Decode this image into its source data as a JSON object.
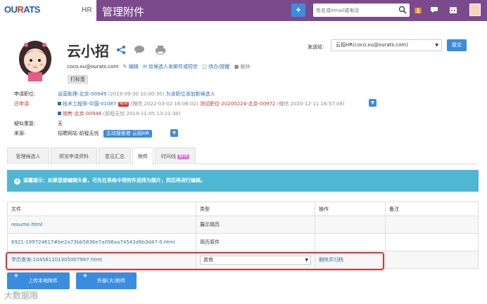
{
  "header": {
    "logo": "OURATS",
    "hr_label": "HR",
    "page_title": "管理附件",
    "search_placeholder": "姓名或email或电话"
  },
  "profile": {
    "name": "云小招",
    "email": "coco.xu@ourats.com",
    "actions": [
      "编辑",
      "给候选人发邮件或短信",
      "待办/提醒",
      "删除"
    ],
    "tag_button": "打标签",
    "forward_label": "发送给:",
    "forward_value": "云招HR(coco.xu@ourats.com)",
    "submit_label": "提交"
  },
  "details": {
    "applied_label": "申请职位:",
    "applied_job": "运营助理-北京-00949",
    "applied_time": "(2019-09-30 10:00:30)",
    "applied_add": "为该职位添加新候选人",
    "also_label": "还申请:",
    "also_jobs": [
      {
        "job": "技术工程师-中国-01087",
        "badge": "NEW",
        "note": "(微信 2022-03-02 16:06:02)",
        "job2": "测试职位-20200224-北京-00972",
        "note2": "(微信 2020-12-11 16:57:08)"
      },
      {
        "job": "销售-北京-00946",
        "note": "(前程无忧 2019-11-05 13:21:30)"
      }
    ],
    "doubt_label": "疑似重复:",
    "doubt_value": "无",
    "source_label": "来源:",
    "source_value": "招聘网站-前程无忧",
    "source_button": "主动搜索者 云招HR"
  },
  "tabs": [
    "管理候选人",
    "预览申请资料",
    "意见汇总",
    "附件",
    "时间线"
  ],
  "tab_beta": "BETA",
  "active_tab": 3,
  "alert": {
    "text": "温馨提示：如果您想编辑头像，可先在表格中将附件选择为图片，然后再进行编辑。"
  },
  "table": {
    "headers": [
      "文件",
      "类型",
      "操作",
      "备注"
    ],
    "rows": [
      {
        "file": "resume.html",
        "type": "展示简历",
        "action": "",
        "note": ""
      },
      {
        "file": "6921-199724617#be2a73bb5836e7a096aa74543d6b3d47-0.html",
        "type": "简历原件",
        "action": "",
        "note": ""
      },
      {
        "file": "学历查询-104561201305007997.html",
        "type": "其他",
        "action": "删除并归档",
        "note": ""
      }
    ]
  },
  "buttons": {
    "upload_local": "上传本地附件",
    "upload_external": "外部(大)附件"
  },
  "watermark": "大数据限",
  "colors": {
    "header_bg": "#7b4a8c",
    "primary": "#3a8dde",
    "alert_bg": "#4fb7d3",
    "highlight": "#e03030"
  }
}
